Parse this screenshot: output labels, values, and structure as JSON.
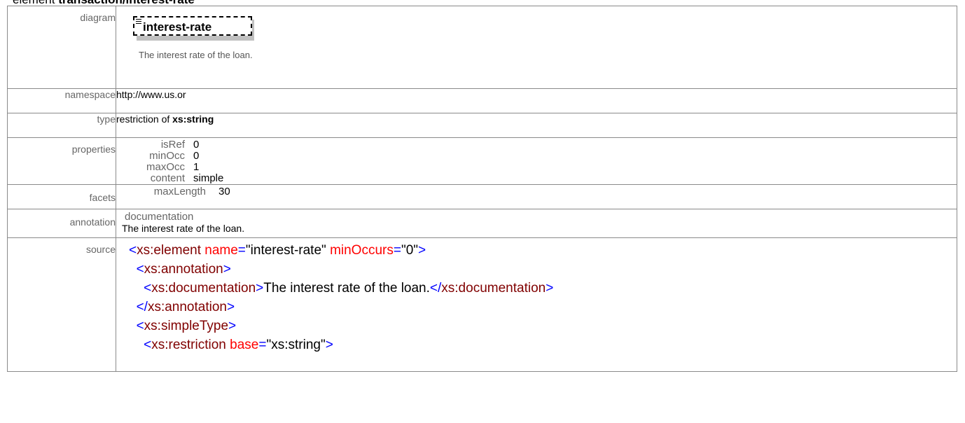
{
  "heading": {
    "prefix": "element ",
    "name": "transaction/interest-rate"
  },
  "rows": {
    "diagram": {
      "label": "diagram",
      "element_name": "interest-rate",
      "doc": "The interest rate of the loan."
    },
    "namespace": {
      "label": "namespace",
      "value": "http://www.us.or"
    },
    "type": {
      "label": "type",
      "prefix": "restriction of ",
      "base": "xs:string"
    },
    "properties": {
      "label": "properties",
      "items": [
        {
          "key": "isRef",
          "value": "0"
        },
        {
          "key": "minOcc",
          "value": "0"
        },
        {
          "key": "maxOcc",
          "value": "1"
        },
        {
          "key": "content",
          "value": "simple"
        }
      ]
    },
    "facets": {
      "label": "facets",
      "items": [
        {
          "key": "maxLength",
          "value": "30"
        }
      ]
    },
    "annotation": {
      "label": "annotation",
      "kind": "documentation",
      "text": "The interest rate of the loan."
    },
    "source": {
      "label": "source",
      "lines": [
        {
          "indent": 0,
          "open": "<",
          "tag": "xs:element",
          "attrs": [
            {
              "name": "name",
              "value": "\"interest-rate\""
            },
            {
              "name": "minOccurs",
              "value": "\"0\""
            }
          ],
          "close": ">",
          "text": "",
          "end_tag": ""
        },
        {
          "indent": 1,
          "open": "<",
          "tag": "xs:annotation",
          "attrs": [],
          "close": ">",
          "text": "",
          "end_tag": ""
        },
        {
          "indent": 2,
          "open": "<",
          "tag": "xs:documentation",
          "attrs": [],
          "close": ">",
          "text": "The interest rate of the loan.",
          "end_tag": "xs:documentation"
        },
        {
          "indent": 1,
          "open": "</",
          "tag": "xs:annotation",
          "attrs": [],
          "close": ">",
          "text": "",
          "end_tag": ""
        },
        {
          "indent": 1,
          "open": "<",
          "tag": "xs:simpleType",
          "attrs": [],
          "close": ">",
          "text": "",
          "end_tag": ""
        },
        {
          "indent": 2,
          "open": "<",
          "tag": "xs:restriction",
          "attrs": [
            {
              "name": "base",
              "value": "\"xs:string\""
            }
          ],
          "close": ">",
          "text": "",
          "end_tag": ""
        }
      ]
    }
  },
  "colors": {
    "tag_bracket": "#0000ff",
    "tag_name": "#800000",
    "attr_name": "#ff0000",
    "label": "#666666"
  }
}
